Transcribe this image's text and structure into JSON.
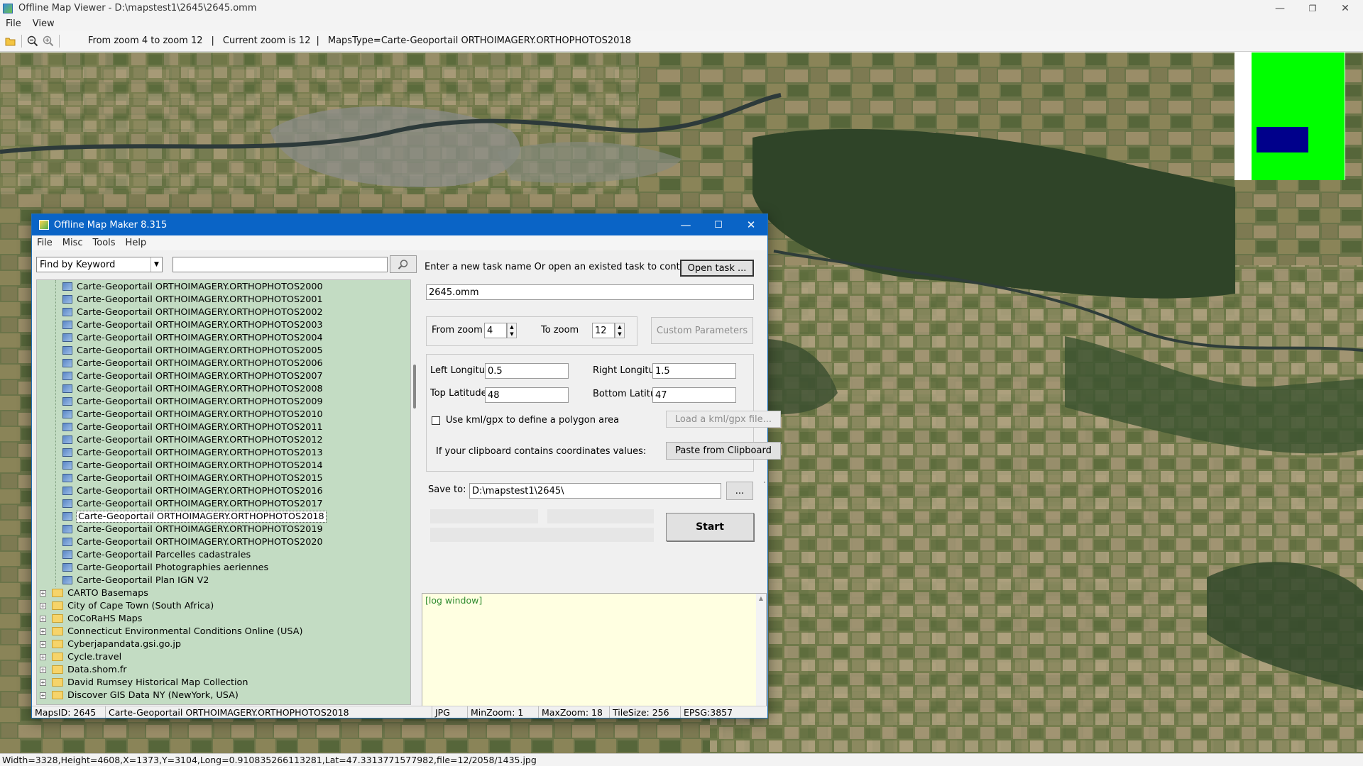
{
  "window": {
    "title": "Offline Map Viewer - D:\\mapstest1\\2645\\2645.omm",
    "minimize": "—",
    "maximize": "❐",
    "close": "✕"
  },
  "menu": {
    "file": "File",
    "view": "View"
  },
  "toolbar": {
    "zoom_range": "From zoom 4 to zoom 12",
    "current_zoom": "Current zoom is 12",
    "maps_type": "MapsType=Carte-Geoportail ORTHOIMAGERY.ORTHOPHOTOS2018",
    "open_icon": "folder-open-icon",
    "zoom_out_icon": "zoom-out-icon",
    "zoom_in_icon": "zoom-in-icon"
  },
  "status": {
    "text": "Width=3328,Height=4608,X=1373,Y=3104,Long=0.910835266113281,Lat=47.3313771577982,file=12/2058/1435.jpg"
  },
  "minimap": {
    "background": "#00ff00",
    "viewport_color": "#00008b"
  },
  "dialog": {
    "title": "Offline Map Maker 8.315",
    "menu": {
      "file": "File",
      "misc": "Misc",
      "tools": "Tools",
      "help": "Help"
    },
    "find": {
      "mode": "Find by Keyword",
      "value": "",
      "search_icon": "search-icon"
    },
    "tree": {
      "items": [
        {
          "label": "Carte-Geoportail ORTHOIMAGERY.ORTHOPHOTOS2000",
          "icon": "map-icon"
        },
        {
          "label": "Carte-Geoportail ORTHOIMAGERY.ORTHOPHOTOS2001",
          "icon": "map-icon"
        },
        {
          "label": "Carte-Geoportail ORTHOIMAGERY.ORTHOPHOTOS2002",
          "icon": "map-icon"
        },
        {
          "label": "Carte-Geoportail ORTHOIMAGERY.ORTHOPHOTOS2003",
          "icon": "map-icon"
        },
        {
          "label": "Carte-Geoportail ORTHOIMAGERY.ORTHOPHOTOS2004",
          "icon": "map-icon"
        },
        {
          "label": "Carte-Geoportail ORTHOIMAGERY.ORTHOPHOTOS2005",
          "icon": "map-icon"
        },
        {
          "label": "Carte-Geoportail ORTHOIMAGERY.ORTHOPHOTOS2006",
          "icon": "map-icon"
        },
        {
          "label": "Carte-Geoportail ORTHOIMAGERY.ORTHOPHOTOS2007",
          "icon": "map-icon"
        },
        {
          "label": "Carte-Geoportail ORTHOIMAGERY.ORTHOPHOTOS2008",
          "icon": "map-icon"
        },
        {
          "label": "Carte-Geoportail ORTHOIMAGERY.ORTHOPHOTOS2009",
          "icon": "map-icon"
        },
        {
          "label": "Carte-Geoportail ORTHOIMAGERY.ORTHOPHOTOS2010",
          "icon": "map-icon"
        },
        {
          "label": "Carte-Geoportail ORTHOIMAGERY.ORTHOPHOTOS2011",
          "icon": "map-icon"
        },
        {
          "label": "Carte-Geoportail ORTHOIMAGERY.ORTHOPHOTOS2012",
          "icon": "map-icon"
        },
        {
          "label": "Carte-Geoportail ORTHOIMAGERY.ORTHOPHOTOS2013",
          "icon": "map-icon"
        },
        {
          "label": "Carte-Geoportail ORTHOIMAGERY.ORTHOPHOTOS2014",
          "icon": "map-icon"
        },
        {
          "label": "Carte-Geoportail ORTHOIMAGERY.ORTHOPHOTOS2015",
          "icon": "map-icon"
        },
        {
          "label": "Carte-Geoportail ORTHOIMAGERY.ORTHOPHOTOS2016",
          "icon": "map-icon"
        },
        {
          "label": "Carte-Geoportail ORTHOIMAGERY.ORTHOPHOTOS2017",
          "icon": "map-icon"
        },
        {
          "label": "Carte-Geoportail ORTHOIMAGERY.ORTHOPHOTOS2018",
          "icon": "map-icon",
          "selected": true
        },
        {
          "label": "Carte-Geoportail ORTHOIMAGERY.ORTHOPHOTOS2019",
          "icon": "map-icon"
        },
        {
          "label": "Carte-Geoportail ORTHOIMAGERY.ORTHOPHOTOS2020",
          "icon": "map-icon"
        },
        {
          "label": "Carte-Geoportail Parcelles cadastrales",
          "icon": "map-icon"
        },
        {
          "label": "Carte-Geoportail Photographies aeriennes",
          "icon": "map-icon"
        },
        {
          "label": "Carte-Geoportail Plan IGN V2",
          "icon": "map-icon"
        },
        {
          "label": "CARTO Basemaps",
          "icon": "folder-icon",
          "folder": true
        },
        {
          "label": "City of Cape Town (South Africa)",
          "icon": "folder-icon",
          "folder": true
        },
        {
          "label": "CoCoRaHS Maps",
          "icon": "folder-icon",
          "folder": true
        },
        {
          "label": "Connecticut Environmental Conditions Online (USA)",
          "icon": "folder-icon",
          "folder": true
        },
        {
          "label": "Cyberjapandata.gsi.go.jp",
          "icon": "folder-icon",
          "folder": true
        },
        {
          "label": "Cycle.travel",
          "icon": "folder-icon",
          "folder": true
        },
        {
          "label": "Data.shom.fr",
          "icon": "folder-icon",
          "folder": true
        },
        {
          "label": "David Rumsey Historical Map Collection",
          "icon": "folder-icon",
          "folder": true
        },
        {
          "label": "Discover GIS Data NY (NewYork, USA)",
          "icon": "folder-icon",
          "folder": true
        }
      ]
    },
    "task": {
      "prompt": "Enter a new task name Or open an existed task to continue:",
      "open_button": "Open task ...",
      "name": "2645.omm"
    },
    "zoom": {
      "from_label": "From zoom",
      "from_value": "4",
      "to_label": "To zoom",
      "to_value": "12",
      "custom_button": "Custom Parameters"
    },
    "coords": {
      "left_lon_label": "Left Longitude",
      "left_lon": "0.5",
      "right_lon_label": "Right Longitude",
      "right_lon": "1.5",
      "top_lat_label": "Top Latitude",
      "top_lat": "48",
      "bottom_lat_label": "Bottom Latitude",
      "bottom_lat": "47",
      "kml_label": "Use kml/gpx to define a polygon area",
      "kml_button": "Load a kml/gpx file...",
      "clipboard_label": "If your clipboard contains coordinates values:",
      "clipboard_button": "Paste from Clipboard"
    },
    "save": {
      "label": "Save to:",
      "path": "D:\\mapstest1\\2645\\",
      "browse": "...",
      "start": "Start"
    },
    "log": {
      "text": "[log window]"
    },
    "statusbar": {
      "maps_id": "MapsID: 2645",
      "map_name": "Carte-Geoportail ORTHOIMAGERY.ORTHOPHOTOS2018",
      "format": "JPG",
      "min_zoom": "MinZoom: 1",
      "max_zoom": "MaxZoom: 18",
      "tile_size": "TileSize: 256",
      "epsg": "EPSG:3857"
    }
  }
}
